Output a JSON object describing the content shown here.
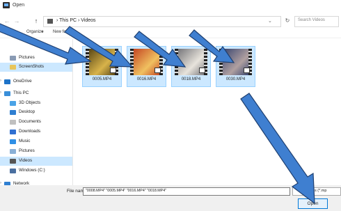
{
  "window": {
    "title": "Open"
  },
  "nav": {
    "back": "←",
    "forward": "→",
    "up": "↑",
    "breadcrumb": "›  This PC  ›  Videos",
    "address_dropdown": "⌄",
    "refresh": "↻",
    "search_placeholder": "Search Videos"
  },
  "toolbar": {
    "organize": "Organize",
    "organize_arrow": "▾",
    "new_folder": "New folder"
  },
  "sidebar": {
    "items": [
      {
        "label": "Pictures",
        "color": "#8a9bb4"
      },
      {
        "label": "ScreenShots",
        "color": "#e8c55a",
        "selected": true
      },
      {
        "label": "OneDrive",
        "color": "#1e73c8"
      },
      {
        "label": "This PC",
        "color": "#3a8fd9"
      },
      {
        "label": "3D Objects",
        "color": "#4aa3e6"
      },
      {
        "label": "Desktop",
        "color": "#2f7fd1"
      },
      {
        "label": "Documents",
        "color": "#c0c0c0"
      },
      {
        "label": "Downloads",
        "color": "#2f6fd1"
      },
      {
        "label": "Music",
        "color": "#2f8fe6"
      },
      {
        "label": "Pictures",
        "color": "#8ab0d6"
      },
      {
        "label": "Videos",
        "color": "#555555",
        "selected": true
      },
      {
        "label": "Windows (C:)",
        "color": "#4a6fa0"
      },
      {
        "label": "Network",
        "color": "#2f7fd1"
      }
    ]
  },
  "files": [
    {
      "name": "0005.MP4",
      "colors": [
        "#4a3a10",
        "#d8b34a"
      ]
    },
    {
      "name": "0016.MP4",
      "colors": [
        "#c0391c",
        "#f0c060"
      ]
    },
    {
      "name": "0018.MP4",
      "colors": [
        "#6a6a70",
        "#e8e4dc"
      ]
    },
    {
      "name": "0030.MP4",
      "colors": [
        "#2a3a6a",
        "#b0a0a0"
      ]
    }
  ],
  "bottom": {
    "file_name_label": "File name:",
    "file_name_value": "\"0008.MP4\" \"0005.MP4\" \"0016.MP4\" \"0018.MP4\"",
    "filter": "files (*.mp",
    "open_button": "Open"
  },
  "annotation": {
    "arrow_color": "#3f7fd0",
    "arrow_outline": "#1e3f70"
  }
}
